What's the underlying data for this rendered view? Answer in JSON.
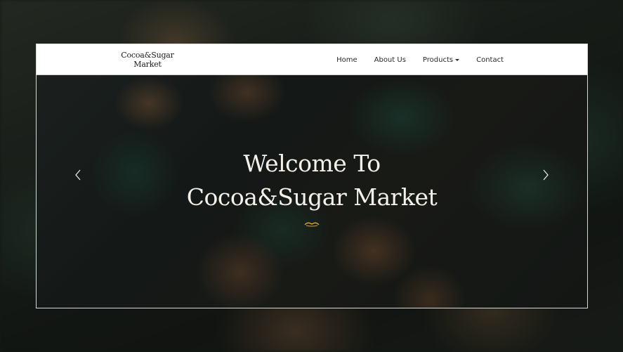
{
  "site": {
    "brand_line1": "Cocoa&Sugar",
    "brand_line2": "Market"
  },
  "nav": {
    "items": [
      {
        "label": "Home"
      },
      {
        "label": "About Us"
      },
      {
        "label": "Products",
        "has_dropdown": true
      },
      {
        "label": "Contact"
      }
    ]
  },
  "hero": {
    "title_line1": "Welcome To",
    "title_line2": "Cocoa&Sugar Market",
    "prev_icon": "chevron-left-icon",
    "next_icon": "chevron-right-icon"
  },
  "colors": {
    "navbar_bg": "#ffffff",
    "hero_text": "#f4f1ea",
    "ornament": "#d4a829"
  }
}
